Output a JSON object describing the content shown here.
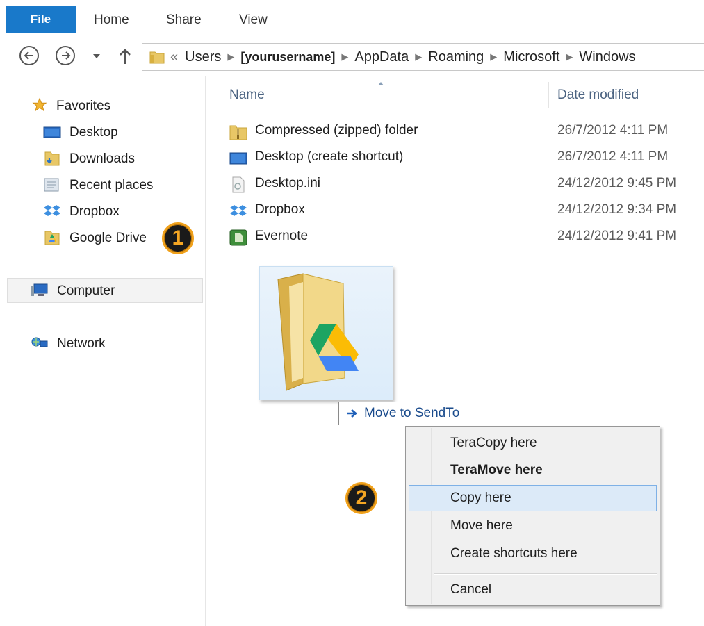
{
  "ribbon": {
    "tabs": [
      "File",
      "Home",
      "Share",
      "View"
    ]
  },
  "nav": {
    "back_icon": "back-arrow-icon",
    "forward_icon": "forward-arrow-icon",
    "up_icon": "up-arrow-icon"
  },
  "address": {
    "overflow": "«",
    "crumbs": [
      "Users",
      "[yourusername]",
      "AppData",
      "Roaming",
      "Microsoft",
      "Windows"
    ]
  },
  "sidebar": {
    "favorites_label": "Favorites",
    "favorites": [
      "Desktop",
      "Downloads",
      "Recent places",
      "Dropbox",
      "Google Drive"
    ],
    "computer_label": "Computer",
    "network_label": "Network"
  },
  "columns": {
    "name": "Name",
    "date": "Date modified"
  },
  "files": [
    {
      "name": "Compressed (zipped) folder",
      "date": "26/7/2012 4:11 PM",
      "icon": "zip-folder-icon"
    },
    {
      "name": "Desktop (create shortcut)",
      "date": "26/7/2012 4:11 PM",
      "icon": "desktop-icon"
    },
    {
      "name": "Desktop.ini",
      "date": "24/12/2012 9:45 PM",
      "icon": "ini-file-icon"
    },
    {
      "name": "Dropbox",
      "date": "24/12/2012 9:34 PM",
      "icon": "dropbox-icon"
    },
    {
      "name": "Evernote",
      "date": "24/12/2012 9:41 PM",
      "icon": "evernote-icon"
    }
  ],
  "badges": {
    "one": "1",
    "two": "2"
  },
  "drag": {
    "tooltip": "Move to SendTo"
  },
  "context_menu": {
    "items": [
      "TeraCopy here",
      "TeraMove here",
      "Copy here",
      "Move here",
      "Create shortcuts here",
      "Cancel"
    ],
    "highlighted": "Copy here",
    "bold": "TeraMove here"
  },
  "colors": {
    "file_tab": "#1979ca",
    "badge_ring": "#f0a11b",
    "menu_highlight": "#dceaf8"
  }
}
